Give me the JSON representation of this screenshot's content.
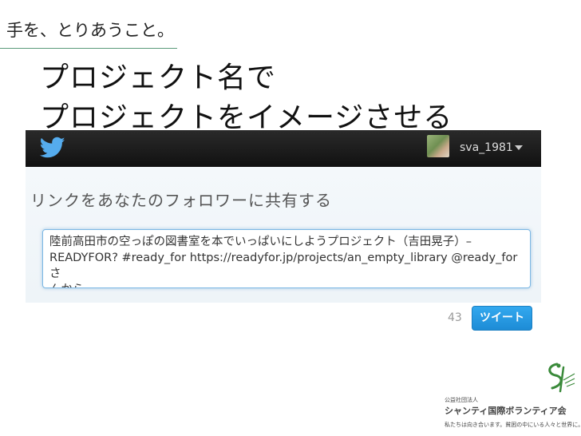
{
  "slide": {
    "motto": "手を、とりあうこと。",
    "title_line1": "プロジェクト名で",
    "title_line2": "プロジェクトをイメージさせる"
  },
  "twitter": {
    "username": "sva_1981",
    "share_heading": "リンクをあなたのフォロワーに共有する",
    "tweet_text": "陸前高田市の空っぽの図書室を本でいっぱいにしようプロジェクト（吉田晃子）–\nREADYFOR? #ready_for https://readyfor.jp/projects/an_empty_library @ready_forさ\nんから",
    "char_count": "43",
    "tweet_button": "ツイート",
    "icons": {
      "logo": "twitter-bird-icon",
      "menu": "chevron-down-icon"
    },
    "colors": {
      "topbar": "#1a1a1a",
      "bird": "#55acee",
      "button": "#2b9de8"
    }
  },
  "organization": {
    "small_label": "公益社団法人",
    "name": "シャンティ国際ボランティア会",
    "tagline": "私たちは向き合います。貧困の中にいる人々と世界に。"
  }
}
